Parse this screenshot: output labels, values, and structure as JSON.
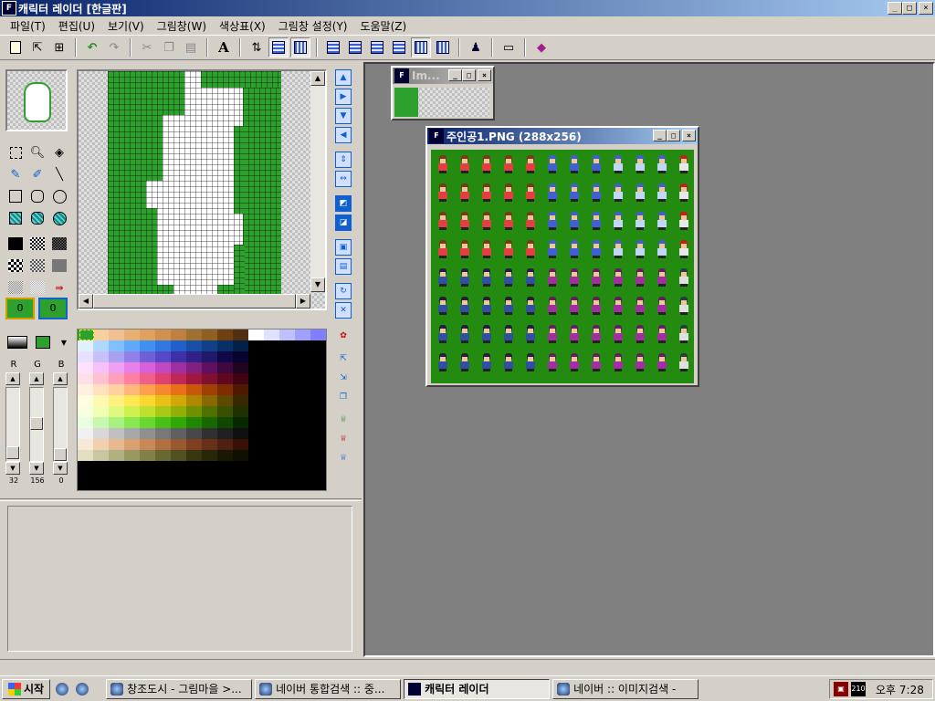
{
  "window": {
    "app_icon": "F 2000",
    "title": "캐릭터 레이더 [한글판]",
    "caption_buttons": [
      "_",
      "□",
      "×"
    ]
  },
  "menu": [
    "파일(T)",
    "편집(U)",
    "보기(V)",
    "그림창(W)",
    "색상표(X)",
    "그림창 설정(Y)",
    "도움말(Z)"
  ],
  "toolbar": {
    "text_tool_label": "A",
    "icons": [
      "new-doc-icon",
      "open-icon",
      "import-icon",
      "undo-icon",
      "redo-icon",
      "cut-icon",
      "copy-icon",
      "paste-icon",
      "text-icon",
      "swap-icon",
      "grid-icon",
      "grid2-icon",
      "layout-icons",
      "character-icon",
      "view-icon",
      "book-icon"
    ]
  },
  "tools": {
    "layer1_label": "0",
    "layer2_label": "0"
  },
  "rgb": {
    "labels": [
      "R",
      "G",
      "B"
    ],
    "values": [
      "32",
      "156",
      "0"
    ]
  },
  "mdi": {
    "small_window": {
      "title": "Im..."
    },
    "sprite_window": {
      "title": "주인공1.PNG (288x256)"
    }
  },
  "taskbar": {
    "start_label": "시작",
    "tasks": [
      {
        "label": "창조도시 - 그림마을 >..."
      },
      {
        "label": "네이버 통합검색 :: 중..."
      },
      {
        "label": "캐릭터 레이더"
      },
      {
        "label": "네이버 :: 이미지검색 -"
      }
    ],
    "tray_badge": "210",
    "clock": "오후 7:28"
  },
  "colors": {
    "title_active": "#0a246a",
    "sprite_bg": "#228b10",
    "pixel_green": "#2ea02e",
    "mdi_bg": "#808080"
  }
}
